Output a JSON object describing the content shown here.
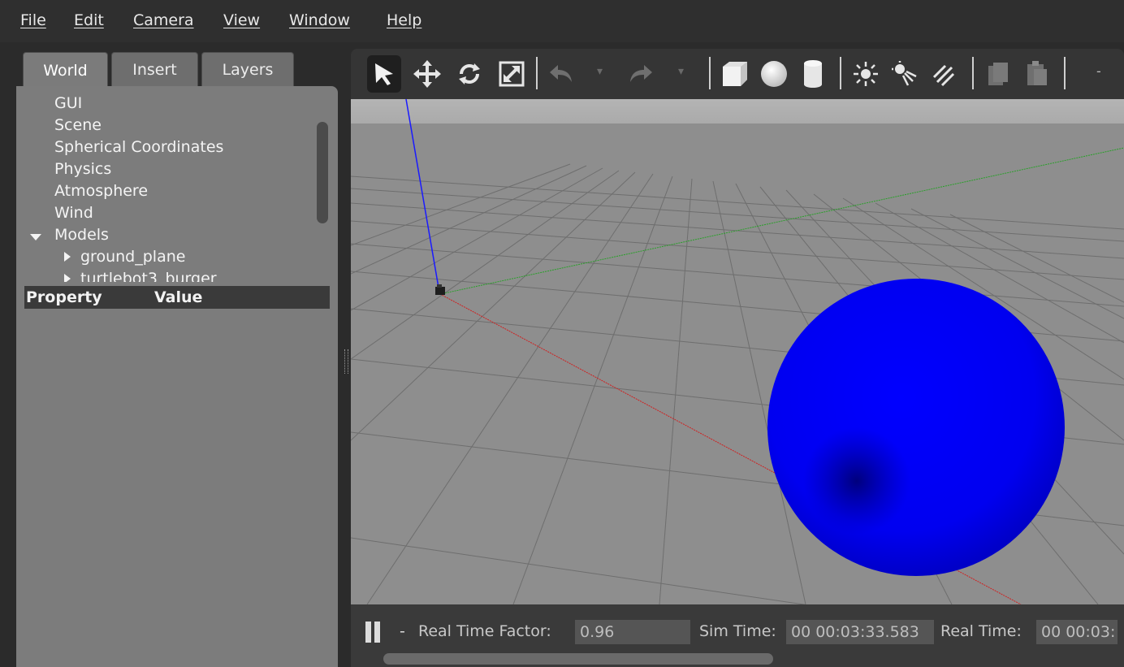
{
  "menu": {
    "file": "File",
    "edit": "Edit",
    "camera": "Camera",
    "view": "View",
    "window": "Window",
    "help": "Help"
  },
  "tabs": {
    "world": "World",
    "insert": "Insert",
    "layers": "Layers",
    "active": "World"
  },
  "tree": {
    "gui": "GUI",
    "scene": "Scene",
    "spherical": "Spherical Coordinates",
    "physics": "Physics",
    "atmosphere": "Atmosphere",
    "wind": "Wind",
    "models": "Models",
    "ground_plane": "ground_plane",
    "turtlebot": "turtlebot3_burger"
  },
  "properties": {
    "property_header": "Property",
    "value_header": "Value"
  },
  "toolbar": {
    "tools": [
      "select-arrow-icon",
      "translate-icon",
      "rotate-icon",
      "scale-icon",
      "undo-icon",
      "redo-icon",
      "box-icon",
      "sphere-icon",
      "cylinder-icon",
      "point-light-icon",
      "spot-light-icon",
      "directional-light-icon",
      "copy-icon",
      "paste-icon"
    ],
    "selected": "select-arrow-icon",
    "overflow": "-"
  },
  "scene": {
    "sphere_color": "#0000ff",
    "x_axis_color": "#d02020",
    "y_axis_color": "#2aa02a",
    "z_axis_color": "#1a1aff"
  },
  "status": {
    "dash": "-",
    "real_time_factor_label": "Real Time Factor:",
    "real_time_factor_value": "0.96",
    "sim_time_label": "Sim Time:",
    "sim_time_value": "00 00:03:33.583",
    "real_time_label": "Real Time:",
    "real_time_value": "00 00:03:"
  }
}
